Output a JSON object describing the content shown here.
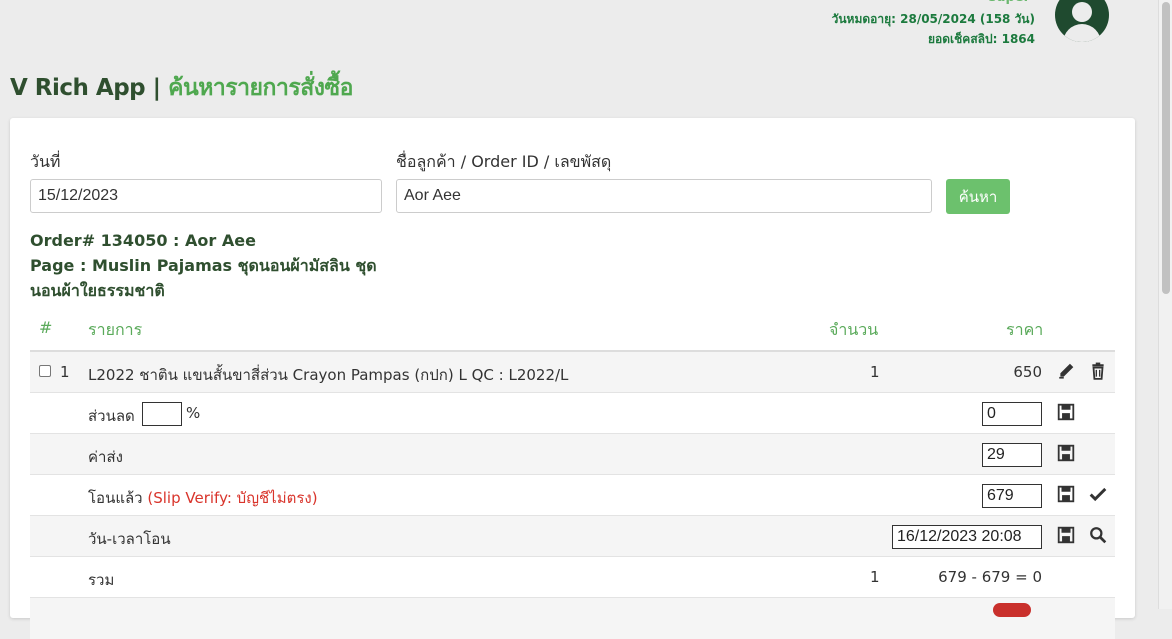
{
  "user": {
    "username": "super",
    "expiry": "วันหมดอายุ: 28/05/2024 (158 วัน)",
    "slip_check": "ยอดเช็คสลิป: 1864"
  },
  "header": {
    "app_name": "V Rich App",
    "separator": "|",
    "page_name": "ค้นหารายการสั่งซื้อ"
  },
  "search": {
    "date_label": "วันที่",
    "date_value": "15/12/2023",
    "customer_label": "ชื่อลูกค้า / Order ID / เลขพัสดุ",
    "customer_value": "Aor Aee",
    "button": "ค้นหา"
  },
  "order": {
    "order_line": "Order# 134050 : Aor Aee",
    "page_line": "Page : Muslin Pajamas ชุดนอนผ้ามัสลิน ชุดนอนผ้าใยธรรมชาติ"
  },
  "table": {
    "headers": {
      "num": "#",
      "item": "รายการ",
      "qty": "จำนวน",
      "price": "ราคา"
    },
    "item": {
      "index": "1",
      "name": "L2022 ชาติน แขนสั้นขาสี่ส่วน Crayon Pampas (กปก) L QC : L2022/L",
      "qty": "1",
      "price": "650"
    },
    "discount": {
      "label": "ส่วนลด",
      "percent_value": "",
      "percent_sign": "%",
      "value": "0"
    },
    "shipping": {
      "label": "ค่าส่ง",
      "value": "29"
    },
    "transferred": {
      "label": "โอนแล้ว",
      "warning": "(Slip Verify: บัญชีไม่ตรง)",
      "value": "679"
    },
    "transfer_time": {
      "label": "วัน-เวลาโอน",
      "value": "16/12/2023 20:08"
    },
    "total": {
      "label": "รวม",
      "qty": "1",
      "calc": "679 - 679 = 0"
    }
  },
  "colors": {
    "accent_green": "#6cc16d",
    "title_green": "#4fa84f",
    "warning_red": "#d9342b",
    "dark_green": "#1f4a2f"
  }
}
